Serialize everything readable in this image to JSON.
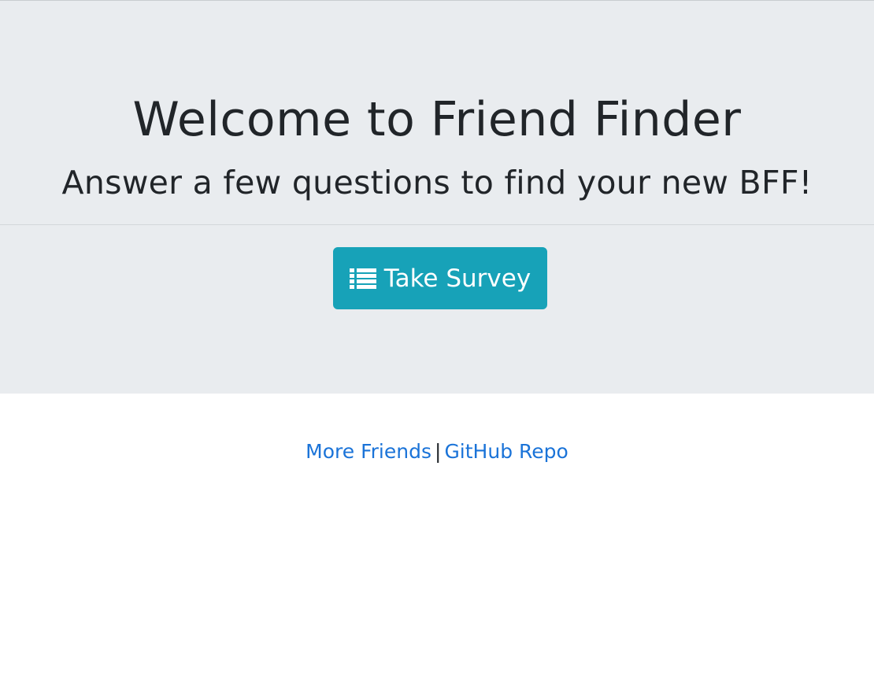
{
  "jumbotron": {
    "title": "Welcome to Friend Finder",
    "subtitle": "Answer a few questions to find your new BFF!",
    "button": {
      "icon": "list-icon",
      "label": "Take Survey",
      "color": "#17a2b8"
    }
  },
  "footer": {
    "links": [
      {
        "label": "More Friends"
      },
      {
        "label": "GitHub Repo"
      }
    ],
    "separator": "|",
    "link_color": "#1a73d8"
  }
}
